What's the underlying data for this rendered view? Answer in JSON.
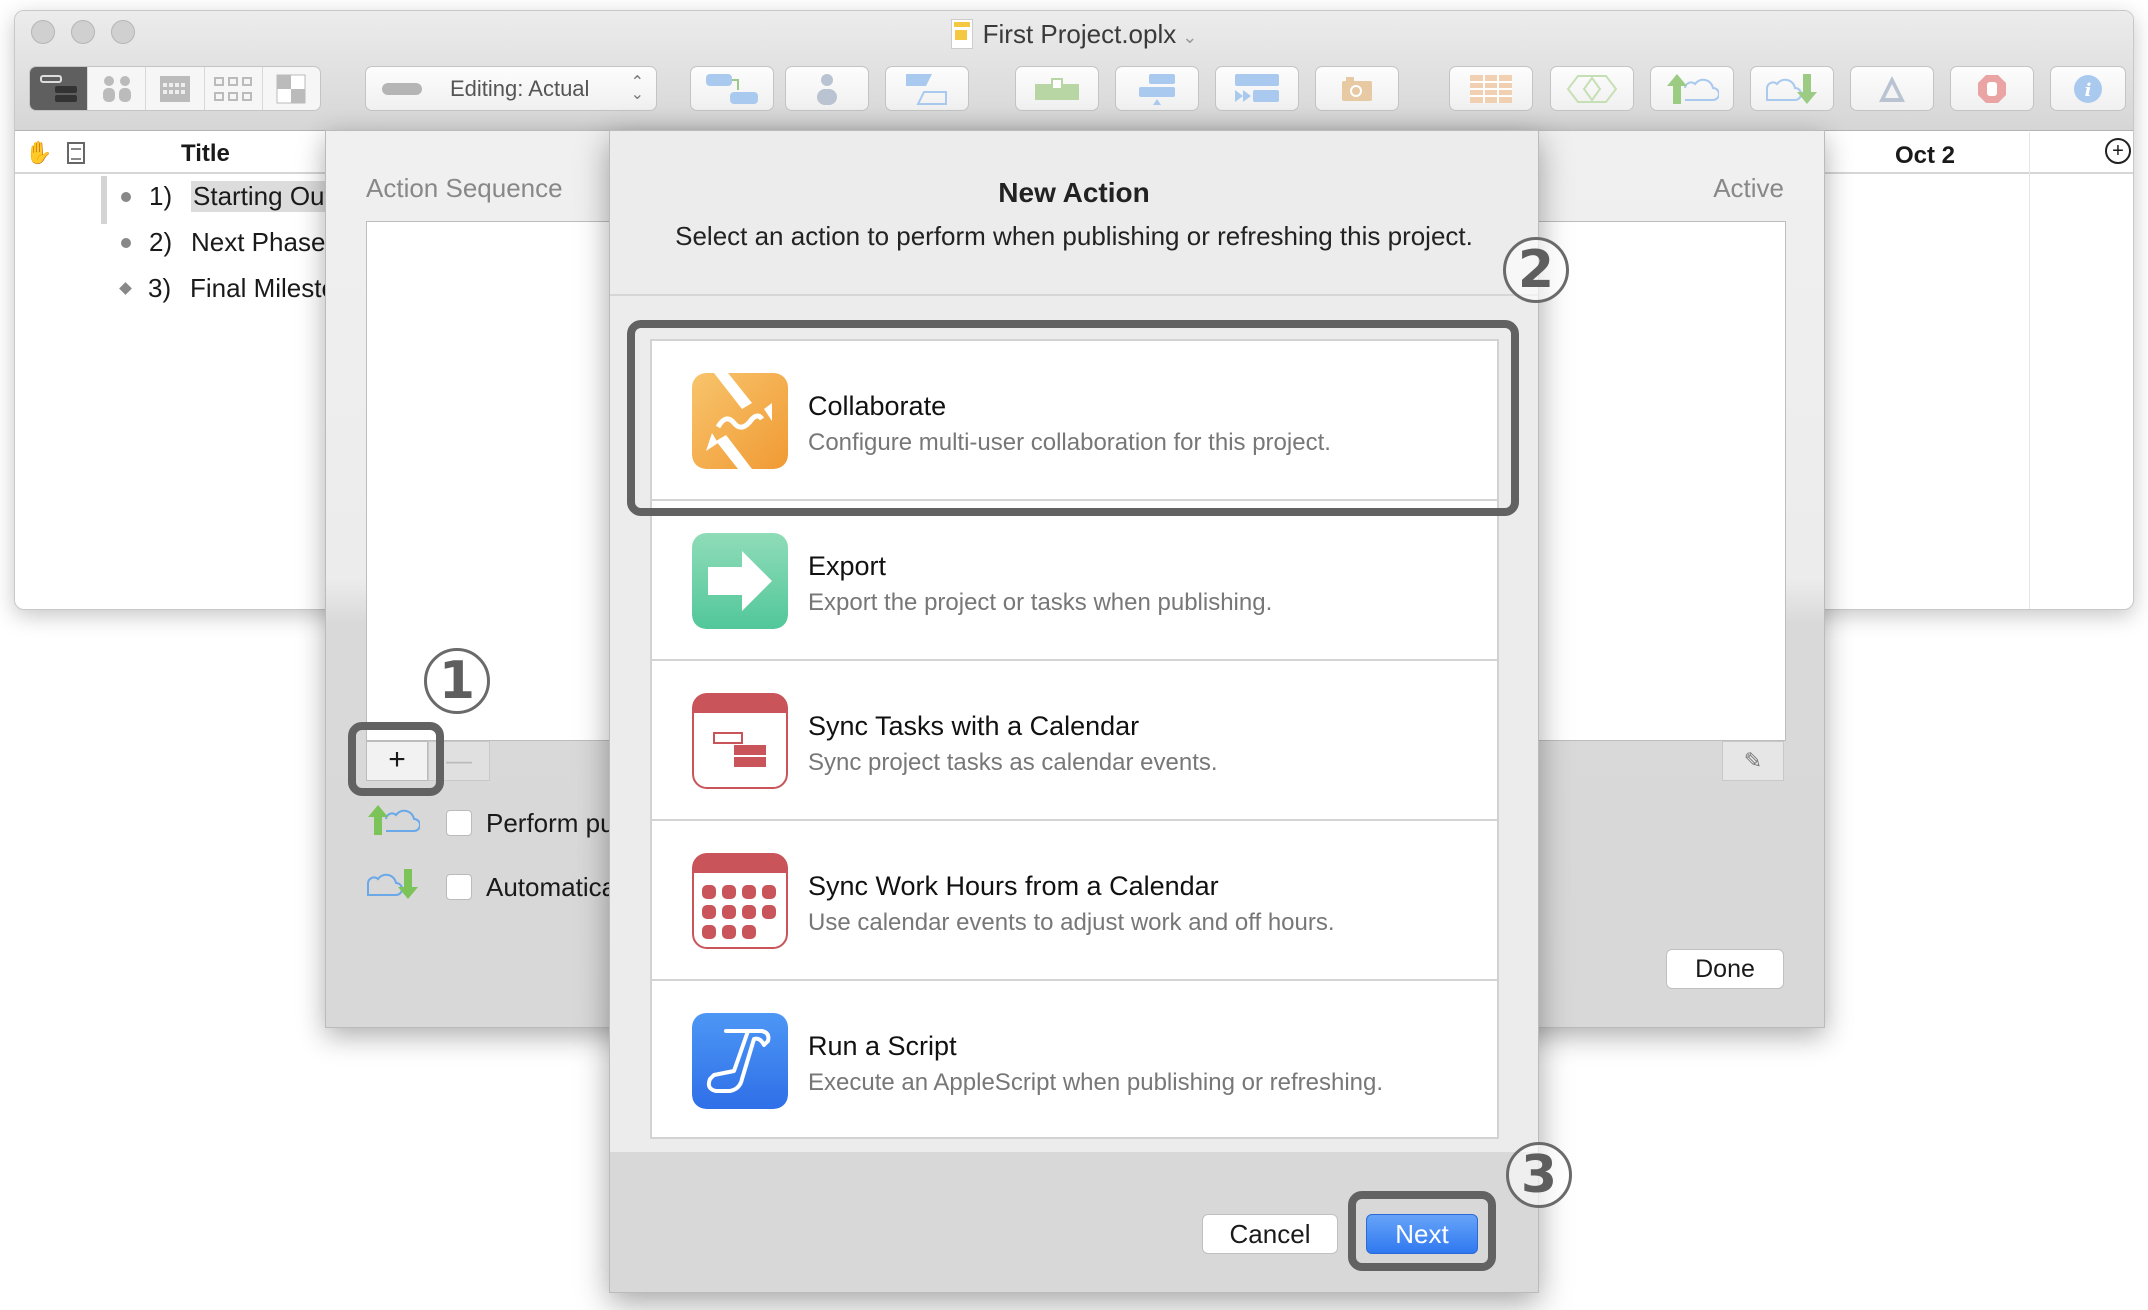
{
  "window": {
    "title": "First Project.oplx",
    "toolbar": {
      "view_modes": [
        "gantt-view",
        "resource-view",
        "calendar-view",
        "network-view",
        "styles-view"
      ],
      "editing_label": "Editing: Actual",
      "buttons": [
        "connect-tasks",
        "assign-resource",
        "task-type",
        "level-resources",
        "catch-up",
        "reschedule",
        "baseline-snapshot",
        "view-table",
        "violations",
        "publish",
        "refresh",
        "change-tracking",
        "stop",
        "inspector"
      ]
    },
    "outline": {
      "title_header": "Title",
      "date_header": "Oct 2",
      "rows": [
        {
          "number": "1)",
          "title": "Starting Out",
          "type": "task",
          "selected": true
        },
        {
          "number": "2)",
          "title": "Next Phase",
          "type": "task",
          "selected": false
        },
        {
          "number": "3)",
          "title": "Final Milesto",
          "type": "milestone",
          "selected": false
        }
      ]
    }
  },
  "sheet": {
    "sequence_label": "Action Sequence",
    "active_label": "Active",
    "add_label": "+",
    "remove_label": "—",
    "checkbox_publish": "Perform pu",
    "checkbox_refresh": "Automatica",
    "done_label": "Done"
  },
  "dialog": {
    "title": "New Action",
    "subtitle": "Select an action to perform when publishing or refreshing this project.",
    "actions": [
      {
        "name": "Collaborate",
        "description": "Configure multi-user collaboration for this project.",
        "color": "#f2a33c"
      },
      {
        "name": "Export",
        "description": "Export the project or tasks when publishing.",
        "color": "#5ccb9c"
      },
      {
        "name": "Sync Tasks with a Calendar",
        "description": "Sync project tasks as calendar events.",
        "color": "#c9545a"
      },
      {
        "name": "Sync Work Hours from a Calendar",
        "description": "Use calendar events to adjust work and off hours.",
        "color": "#c9545a"
      },
      {
        "name": "Run a Script",
        "description": "Execute an AppleScript when publishing or refreshing.",
        "color": "#3a7ef0"
      }
    ],
    "cancel_label": "Cancel",
    "next_label": "Next"
  },
  "annotations": {
    "step1": "1",
    "step2": "2",
    "step3": "3"
  }
}
